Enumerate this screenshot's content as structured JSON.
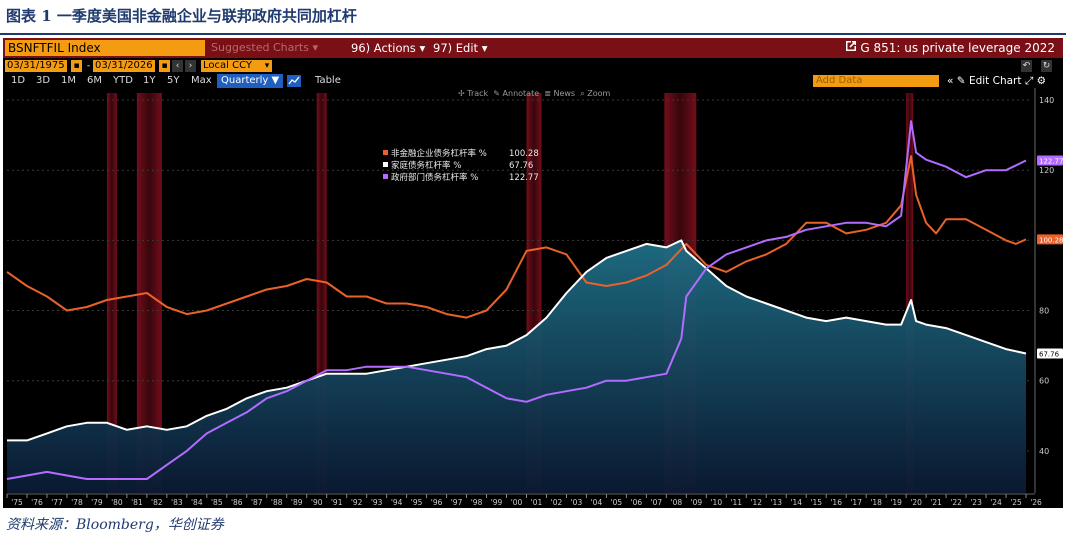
{
  "figure": {
    "title": "图表 1 一季度美国非金融企业与联邦政府共同加杠杆",
    "source": "资料来源：Bloomberg，华创证券"
  },
  "terminal": {
    "ticker": "BSNFTFIL Index",
    "suggested": "Suggested Charts",
    "actions": "96) Actions",
    "edit": "97) Edit",
    "chart_name": "G 851: us private leverage 2022",
    "start_date": "03/31/1975",
    "end_date": "03/31/2026",
    "currency": "Local CCY",
    "ranges": [
      "1D",
      "3D",
      "1M",
      "6M",
      "YTD",
      "1Y",
      "5Y",
      "Max"
    ],
    "frequency": "Quarterly ▼",
    "table_label": "Table",
    "add_data": "Add Data",
    "edit_chart": "Edit Chart",
    "tools": [
      "Track",
      "Annotate",
      "News",
      "Zoom"
    ]
  },
  "chart_data": {
    "type": "line",
    "title": "",
    "ylim": [
      28,
      142
    ],
    "yticks": [
      40,
      60,
      80,
      100,
      120,
      140
    ],
    "xticks": [
      "'75",
      "'76",
      "'77",
      "'78",
      "'79",
      "'80",
      "'81",
      "'82",
      "'83",
      "'84",
      "'85",
      "'86",
      "'87",
      "'88",
      "'89",
      "'90",
      "'91",
      "'92",
      "'93",
      "'94",
      "'95",
      "'96",
      "'97",
      "'98",
      "'99",
      "'00",
      "'01",
      "'02",
      "'03",
      "'04",
      "'05",
      "'06",
      "'07",
      "'08",
      "'09",
      "'10",
      "'11",
      "'12",
      "'13",
      "'14",
      "'15",
      "'16",
      "'17",
      "'18",
      "'19",
      "'20",
      "'21",
      "'22",
      "'23",
      "'24",
      "'25",
      "'26"
    ],
    "xlim": [
      1975.0,
      2026.25
    ],
    "recessions": [
      [
        1980.0,
        1980.5
      ],
      [
        1981.5,
        1982.75
      ],
      [
        1990.5,
        1991.0
      ],
      [
        2001.0,
        2001.75
      ],
      [
        2007.9,
        2009.5
      ],
      [
        2020.0,
        2020.35
      ]
    ],
    "legend": [
      {
        "label": "非金融企业债务杠杆率 %",
        "value": "100.28",
        "color": "#e8622a"
      },
      {
        "label": "家庭债务杠杆率 %",
        "value": "67.76",
        "color": "#ffffff"
      },
      {
        "label": "政府部门债务杠杆率 %",
        "value": "122.77",
        "color": "#b26cff"
      }
    ],
    "last_values": [
      {
        "value": "100.28",
        "y": 100.28,
        "color": "#e8622a"
      },
      {
        "value": "67.76",
        "y": 67.76,
        "color": "#ffffff"
      },
      {
        "value": "122.77",
        "y": 122.77,
        "color": "#b26cff"
      }
    ],
    "series": [
      {
        "name": "非金融企业债务杠杆率",
        "color": "#e8622a",
        "x": [
          1975,
          1976,
          1977,
          1978,
          1979,
          1980,
          1981,
          1982,
          1983,
          1984,
          1985,
          1986,
          1987,
          1988,
          1989,
          1990,
          1991,
          1992,
          1993,
          1994,
          1995,
          1996,
          1997,
          1998,
          1999,
          2000,
          2001,
          2002,
          2003,
          2004,
          2005,
          2006,
          2007,
          2008,
          2009,
          2010,
          2011,
          2012,
          2013,
          2014,
          2015,
          2016,
          2017,
          2018,
          2019,
          2019.75,
          2020.25,
          2020.5,
          2021,
          2021.5,
          2022,
          2023,
          2024,
          2025,
          2025.5,
          2026
        ],
        "y": [
          91,
          87,
          84,
          80,
          81,
          83,
          84,
          85,
          81,
          79,
          80,
          82,
          84,
          86,
          87,
          89,
          88,
          84,
          84,
          82,
          82,
          81,
          79,
          78,
          80,
          86,
          97,
          98,
          96,
          88,
          87,
          88,
          90,
          93,
          99,
          93,
          91,
          94,
          96,
          99,
          105,
          105,
          102,
          103,
          105,
          110,
          124,
          113,
          105,
          102,
          106,
          106,
          103,
          100,
          99,
          100.28
        ]
      },
      {
        "name": "家庭债务杠杆率",
        "color": "#ffffff",
        "x": [
          1975,
          1976,
          1977,
          1978,
          1979,
          1980,
          1981,
          1982,
          1983,
          1984,
          1985,
          1986,
          1987,
          1988,
          1989,
          1990,
          1991,
          1992,
          1993,
          1994,
          1995,
          1996,
          1997,
          1998,
          1999,
          2000,
          2001,
          2002,
          2003,
          2004,
          2005,
          2006,
          2007,
          2008,
          2008.75,
          2009,
          2010,
          2011,
          2012,
          2013,
          2014,
          2015,
          2016,
          2017,
          2018,
          2019,
          2019.75,
          2020.25,
          2020.5,
          2021,
          2022,
          2023,
          2024,
          2025,
          2026
        ],
        "y": [
          43,
          43,
          45,
          47,
          48,
          48,
          46,
          47,
          46,
          47,
          50,
          52,
          55,
          57,
          58,
          60,
          62,
          62,
          62,
          63,
          64,
          65,
          66,
          67,
          69,
          70,
          73,
          78,
          85,
          91,
          95,
          97,
          99,
          98,
          100,
          97,
          92,
          87,
          84,
          82,
          80,
          78,
          77,
          78,
          77,
          76,
          76,
          83,
          77,
          76,
          75,
          73,
          71,
          69,
          67.76
        ]
      },
      {
        "name": "政府部门债务杠杆率",
        "color": "#b26cff",
        "x": [
          1975,
          1976,
          1977,
          1978,
          1979,
          1980,
          1981,
          1982,
          1983,
          1984,
          1985,
          1986,
          1987,
          1988,
          1989,
          1990,
          1991,
          1992,
          1993,
          1994,
          1995,
          1996,
          1997,
          1998,
          1999,
          2000,
          2001,
          2002,
          2003,
          2004,
          2005,
          2006,
          2007,
          2008,
          2008.75,
          2009,
          2010,
          2011,
          2012,
          2013,
          2014,
          2015,
          2016,
          2017,
          2018,
          2019,
          2019.75,
          2020.25,
          2020.5,
          2021,
          2022,
          2023,
          2024,
          2025,
          2026
        ],
        "y": [
          32,
          33,
          34,
          33,
          32,
          32,
          32,
          32,
          36,
          40,
          45,
          48,
          51,
          55,
          57,
          60,
          63,
          63,
          64,
          64,
          64,
          63,
          62,
          61,
          58,
          55,
          54,
          56,
          57,
          58,
          60,
          60,
          61,
          62,
          72,
          84,
          92,
          96,
          98,
          100,
          101,
          103,
          104,
          105,
          105,
          104,
          107,
          134,
          125,
          123,
          121,
          118,
          120,
          120,
          122.77
        ]
      }
    ]
  }
}
